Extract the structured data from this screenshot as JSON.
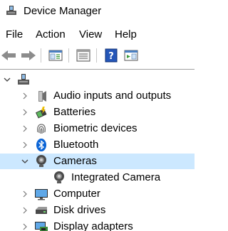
{
  "window": {
    "title": "Device Manager"
  },
  "menu": {
    "items": [
      "File",
      "Action",
      "View",
      "Help"
    ]
  },
  "toolbar": {
    "buttons": [
      "back-arrow-icon",
      "forward-arrow-icon",
      "console-tree-icon",
      "properties-icon",
      "help-icon",
      "action-pane-icon"
    ]
  },
  "tree": {
    "root_icon": "computer-icon",
    "nodes": [
      {
        "label": "Audio inputs and outputs",
        "icon": "speaker-icon",
        "expanded": false
      },
      {
        "label": "Batteries",
        "icon": "battery-icon",
        "expanded": false
      },
      {
        "label": "Biometric devices",
        "icon": "fingerprint-icon",
        "expanded": false
      },
      {
        "label": "Bluetooth",
        "icon": "bluetooth-icon",
        "expanded": false
      },
      {
        "label": "Cameras",
        "icon": "camera-icon",
        "expanded": true,
        "selected": true
      },
      {
        "label": "Integrated Camera",
        "icon": "camera-icon",
        "child": true
      },
      {
        "label": "Computer",
        "icon": "monitor-icon",
        "expanded": false
      },
      {
        "label": "Disk drives",
        "icon": "disk-drive-icon",
        "expanded": false
      },
      {
        "label": "Display adapters",
        "icon": "display-adapter-icon",
        "expanded": false
      }
    ]
  },
  "colors": {
    "selection": "#cce8ff",
    "divider": "#a0a0a0",
    "bluetooth": "#0a64d6"
  }
}
